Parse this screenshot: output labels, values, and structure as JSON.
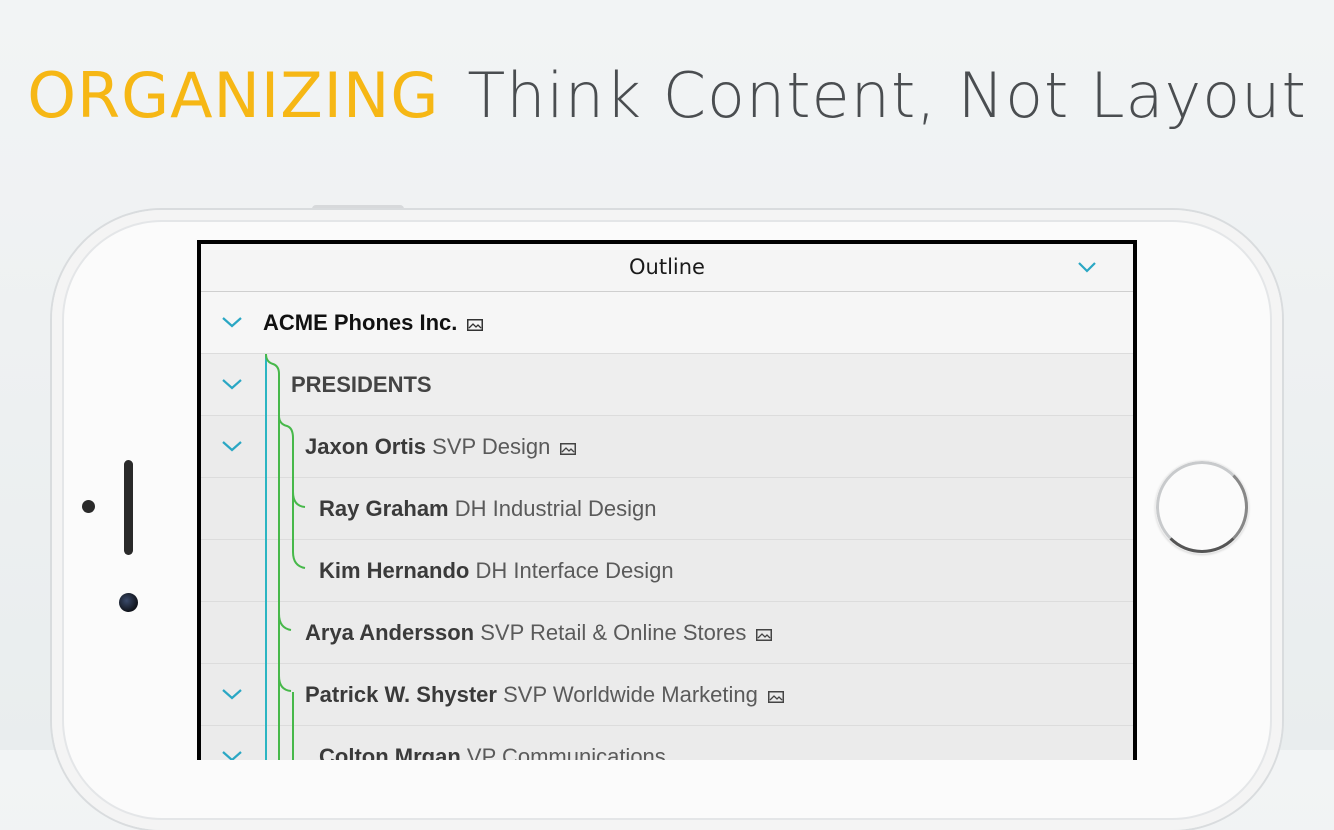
{
  "headline": {
    "accent": "ORGANIZING",
    "rest": "Think Content, Not Layout"
  },
  "app": {
    "nav_title": "Outline"
  },
  "colors": {
    "accent": "#f6b715",
    "chevron": "#2aa7c4",
    "tree_teal": "#2bb5c2",
    "tree_green": "#47b84a"
  },
  "rows": [
    {
      "name": "ACME Phones Inc.",
      "title": "",
      "has_image": true,
      "expanded": true
    },
    {
      "name": "PRESIDENTS",
      "title": "",
      "has_image": false,
      "expanded": true
    },
    {
      "name": "Jaxon Ortis",
      "title": "SVP Design",
      "has_image": true,
      "expanded": true
    },
    {
      "name": "Ray Graham",
      "title": "DH Industrial Design",
      "has_image": false,
      "expanded": false
    },
    {
      "name": "Kim Hernando",
      "title": "DH Interface Design",
      "has_image": false,
      "expanded": false
    },
    {
      "name": "Arya Andersson",
      "title": "SVP Retail & Online Stores",
      "has_image": true,
      "expanded": false
    },
    {
      "name": "Patrick W. Shyster",
      "title": "SVP Worldwide Marketing",
      "has_image": true,
      "expanded": true
    },
    {
      "name": "Colton Mrgan",
      "title": "VP Communications",
      "has_image": false,
      "expanded": true
    }
  ]
}
